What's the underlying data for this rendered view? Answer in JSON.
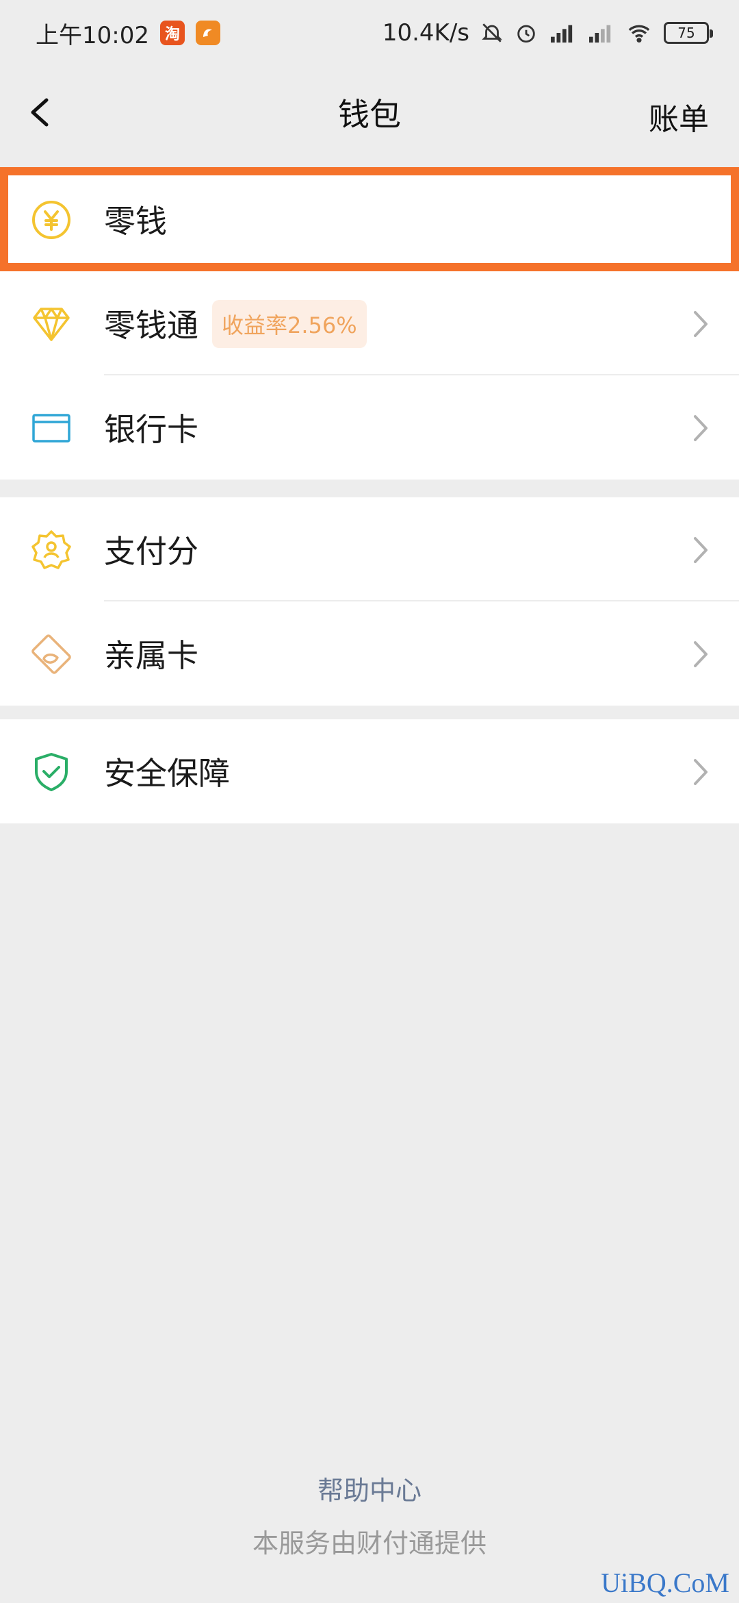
{
  "status_bar": {
    "time": "上午10:02",
    "app1": "淘",
    "app2": "UC",
    "network_speed": "10.4K/s",
    "battery": "75"
  },
  "nav": {
    "title": "钱包",
    "bill_label": "账单"
  },
  "groups": [
    {
      "items": [
        {
          "label": "零钱",
          "icon": "yuan-coin-icon",
          "highlighted": true
        },
        {
          "label": "零钱通",
          "icon": "diamond-icon",
          "badge": "收益率2.56%"
        },
        {
          "label": "银行卡",
          "icon": "bank-card-icon"
        }
      ]
    },
    {
      "items": [
        {
          "label": "支付分",
          "icon": "payscore-badge-icon"
        },
        {
          "label": "亲属卡",
          "icon": "family-card-icon"
        }
      ]
    },
    {
      "items": [
        {
          "label": "安全保障",
          "icon": "shield-check-icon"
        }
      ]
    }
  ],
  "footer": {
    "help": "帮助中心",
    "provider": "本服务由财付通提供"
  },
  "watermark": "UiBQ.CoM",
  "colors": {
    "highlight_border": "#f5722a",
    "yellow_icon": "#f4c430",
    "blue_icon": "#2fa6d6",
    "orange_icon": "#e9b37a",
    "green_icon": "#2aae67",
    "badge_text": "#f0a45d",
    "badge_bg": "#fdeee4"
  }
}
